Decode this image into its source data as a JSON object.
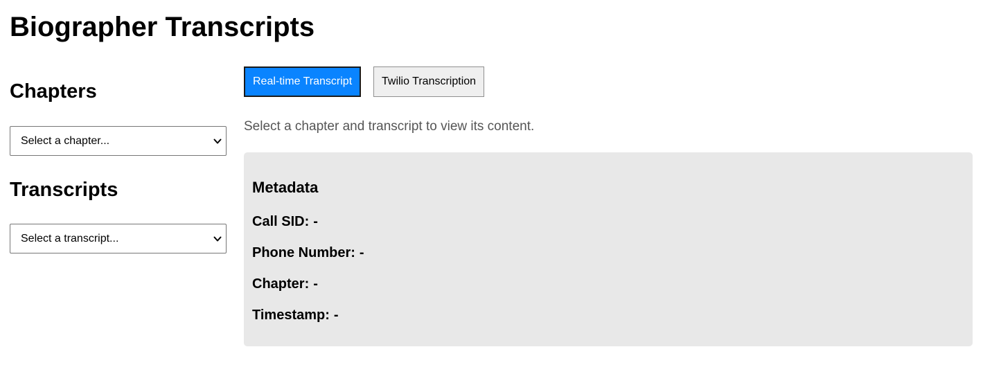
{
  "page": {
    "title": "Biographer Transcripts"
  },
  "sidebar": {
    "chapters_heading": "Chapters",
    "chapter_select": {
      "selected": "Select a chapter..."
    },
    "transcripts_heading": "Transcripts",
    "transcript_select": {
      "selected": "Select a transcript..."
    }
  },
  "main": {
    "tabs": [
      {
        "label": "Real-time Transcript",
        "active": true
      },
      {
        "label": "Twilio Transcription",
        "active": false
      }
    ],
    "hint": "Select a chapter and transcript to view its content.",
    "metadata": {
      "title": "Metadata",
      "rows": [
        {
          "label": "Call SID:",
          "value": "-"
        },
        {
          "label": "Phone Number:",
          "value": "-"
        },
        {
          "label": "Chapter:",
          "value": "-"
        },
        {
          "label": "Timestamp:",
          "value": "-"
        }
      ]
    }
  },
  "colors": {
    "accent": "#0a84ff",
    "panel_bg": "#e8e8e8",
    "hint_text": "#555555"
  },
  "icons": {
    "select_chevron": "chevron-down-icon"
  }
}
